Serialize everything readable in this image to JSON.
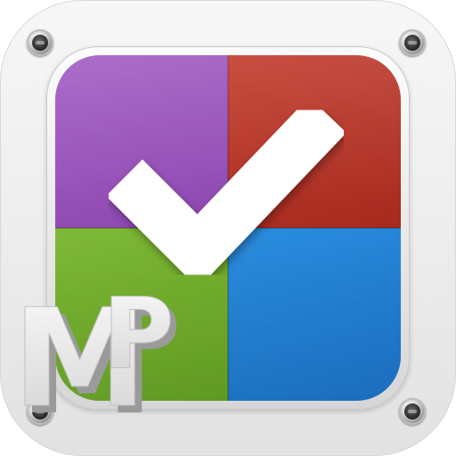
{
  "icon": {
    "monogram_first": "M",
    "monogram_second": "P",
    "glyph": "checkmark-icon",
    "colors": {
      "frame": "#ececec",
      "purple": "#9b52bf",
      "red": "#b83224",
      "green": "#74b02f",
      "blue": "#2483d6",
      "check": "#ffffff",
      "monogram": "#e9e9e9"
    }
  }
}
